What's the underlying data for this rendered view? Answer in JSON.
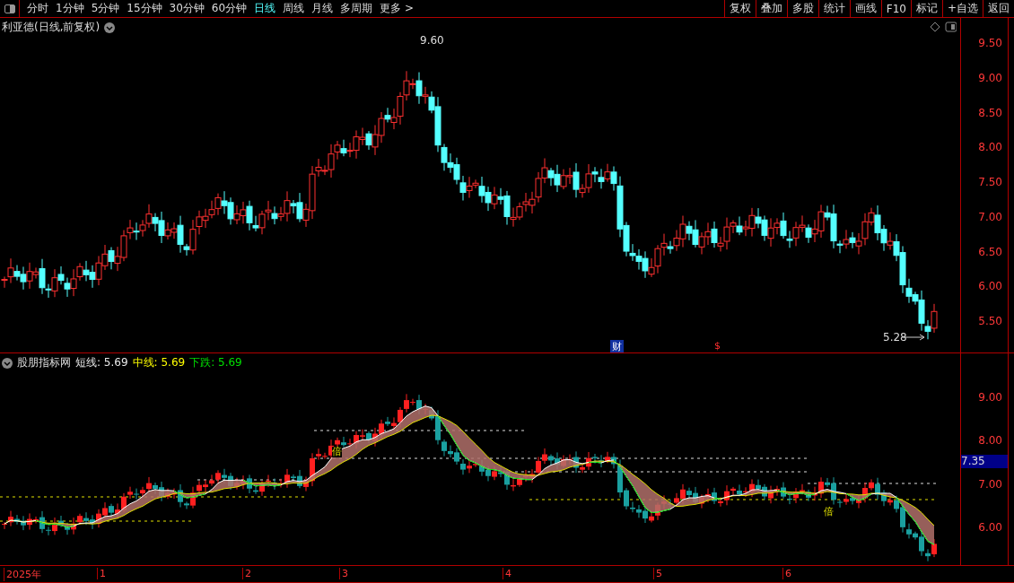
{
  "toolbar": {
    "tabs": [
      {
        "label": "分时",
        "selected": false
      },
      {
        "label": "1分钟",
        "selected": false
      },
      {
        "label": "5分钟",
        "selected": false
      },
      {
        "label": "15分钟",
        "selected": false
      },
      {
        "label": "30分钟",
        "selected": false
      },
      {
        "label": "60分钟",
        "selected": false
      },
      {
        "label": "日线",
        "selected": true
      },
      {
        "label": "周线",
        "selected": false
      },
      {
        "label": "月线",
        "selected": false
      },
      {
        "label": "多周期",
        "selected": false
      },
      {
        "label": "更多 >",
        "selected": false
      }
    ],
    "buttons": [
      "复权",
      "叠加",
      "多股",
      "统计",
      "画线",
      "F10",
      "标记",
      "+自选",
      "返回"
    ]
  },
  "price_chart": {
    "title": "利亚德(日线,前复权)",
    "high_label": "9.60",
    "low_label": "5.28",
    "ticks": [
      "9.50",
      "9.00",
      "8.50",
      "8.00",
      "7.50",
      "7.00",
      "6.50",
      "6.00",
      "5.50"
    ],
    "events": [
      {
        "text": "财",
        "kind": "finance"
      },
      {
        "text": "$",
        "kind": "dollar"
      }
    ]
  },
  "indicator": {
    "name": "股朋指标网",
    "lines": [
      {
        "label": "短线:",
        "value": "5.69",
        "color": "#e8e8e8"
      },
      {
        "label": "中线:",
        "value": "5.69",
        "color": "#ffff00"
      },
      {
        "label": "下跌:",
        "value": "5.69",
        "color": "#00e000"
      }
    ],
    "ticks": [
      "9.00",
      "8.00",
      "7.00",
      "6.00"
    ],
    "cursor_value": "7.35",
    "signals": [
      "倍",
      "倍"
    ]
  },
  "time_axis": {
    "labels": [
      "2025年",
      "1",
      "2",
      "3",
      "4",
      "5",
      "6"
    ]
  }
}
